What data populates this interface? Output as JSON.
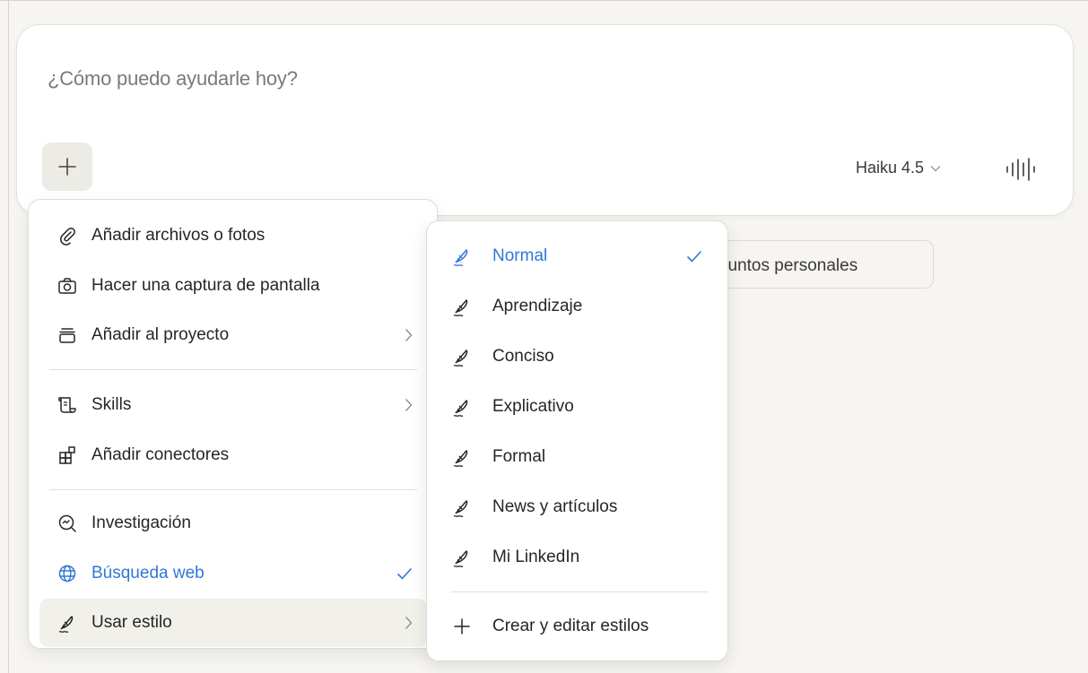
{
  "composer": {
    "placeholder": "¿Cómo puedo ayudarle hoy?",
    "model": "Haiku 4.5",
    "plus_icon": "plus-icon",
    "voice_icon": "voice-waveform-icon"
  },
  "suggestion_chip": {
    "label": "suntos personales"
  },
  "menu": {
    "items": [
      {
        "label": "Añadir archivos o fotos",
        "icon": "paperclip-icon"
      },
      {
        "label": "Hacer una captura de pantalla",
        "icon": "camera-icon"
      },
      {
        "label": "Añadir al proyecto",
        "icon": "project-box-icon"
      },
      {
        "label": "Skills",
        "icon": "scroll-icon"
      },
      {
        "label": "Añadir conectores",
        "icon": "connectors-icon"
      },
      {
        "label": "Investigación",
        "icon": "research-icon"
      },
      {
        "label": "Búsqueda web",
        "icon": "globe-icon",
        "checked": true
      },
      {
        "label": "Usar estilo",
        "icon": "quill-icon"
      }
    ]
  },
  "style_menu": {
    "items": [
      {
        "label": "Normal",
        "checked": true
      },
      {
        "label": "Aprendizaje"
      },
      {
        "label": "Conciso"
      },
      {
        "label": "Explicativo"
      },
      {
        "label": "Formal"
      },
      {
        "label": "News y artículos"
      },
      {
        "label": "Mi LinkedIn"
      }
    ],
    "create_label": "Crear y editar estilos"
  },
  "colors": {
    "accent": "#2f77d6",
    "background": "#f6f5f1"
  }
}
